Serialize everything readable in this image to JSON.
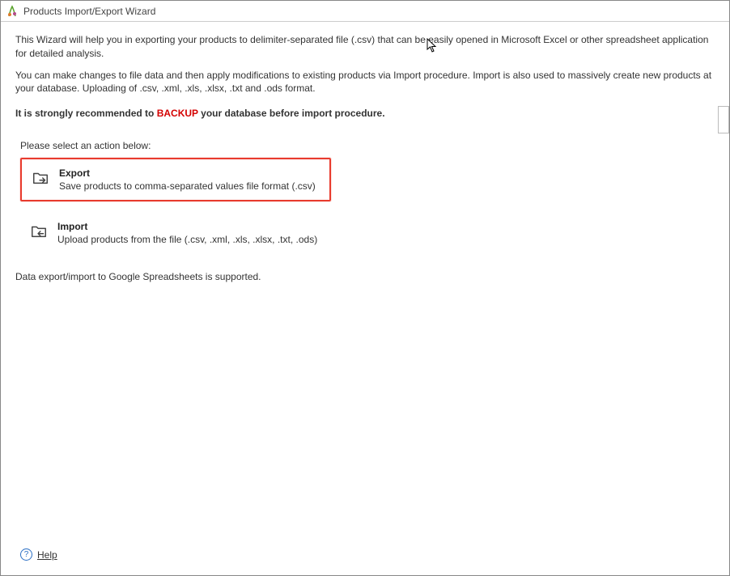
{
  "window": {
    "title": "Products Import/Export Wizard"
  },
  "intro": {
    "p1": "This Wizard will help you in exporting your products to delimiter-separated file (.csv) that can be easily opened in Microsoft Excel or other spreadsheet application for detailed analysis.",
    "p2": "You can make changes to file data and then apply modifications to existing products via Import procedure. Import is also used to massively create new products at your database. Uploading of .csv, .xml, .xls, .xlsx, .txt and .ods format."
  },
  "recommend": {
    "pre": "It is strongly recommended to ",
    "backup": "BACKUP",
    "post": " your database before import procedure."
  },
  "select_label": "Please select an action below:",
  "options": {
    "export": {
      "title": "Export",
      "desc": "Save products to comma-separated values file format (.csv)"
    },
    "import": {
      "title": "Import",
      "desc": "Upload products from the file (.csv, .xml, .xls, .xlsx, .txt, .ods)"
    }
  },
  "footer_note": "Data export/import to Google Spreadsheets is supported.",
  "help": {
    "label": "Help"
  }
}
